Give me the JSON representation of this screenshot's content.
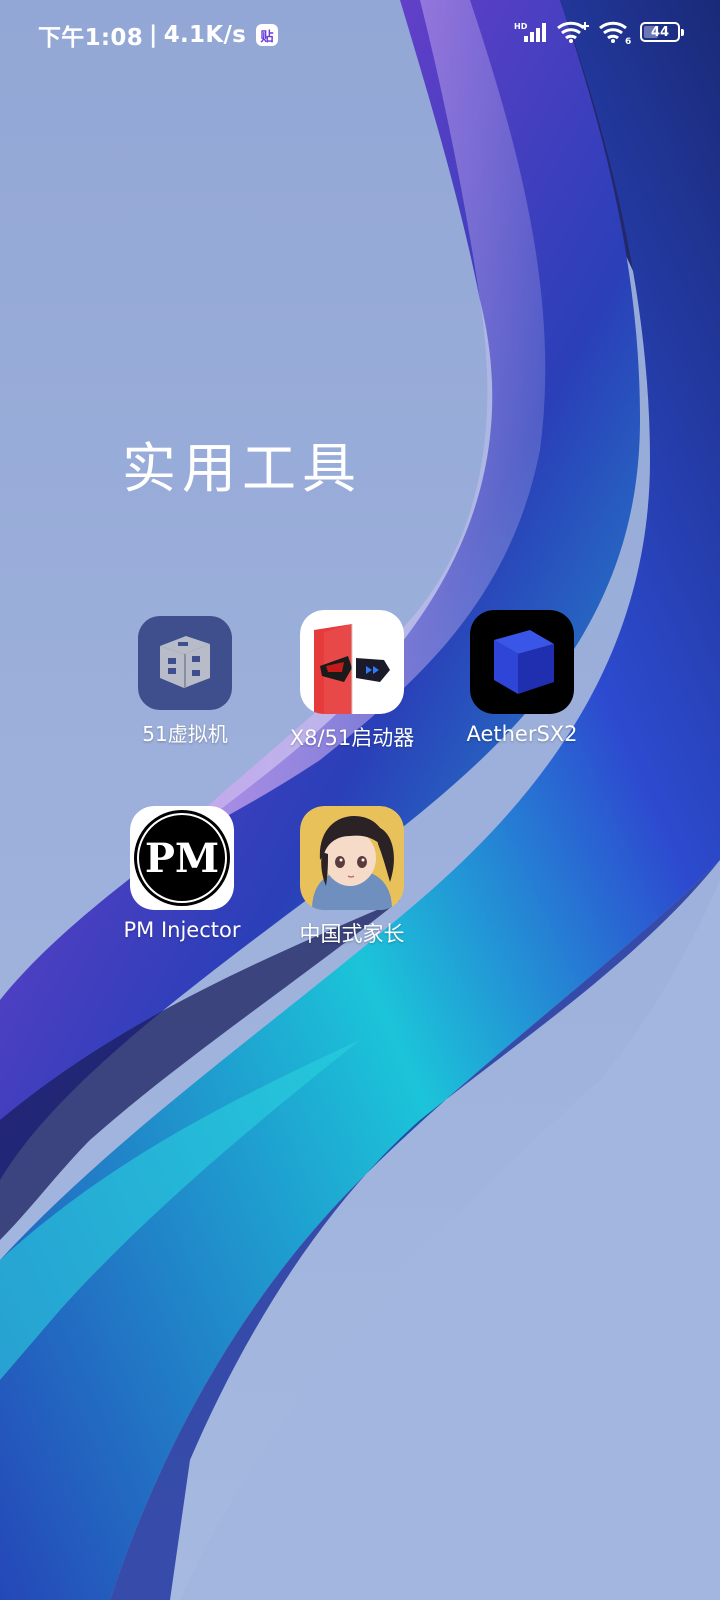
{
  "status_bar": {
    "time": "下午1:08",
    "separator": "|",
    "network_speed": "4.1K/s",
    "notification_badge": "贴",
    "battery_level": "44",
    "battery_percent": 44,
    "icons": [
      "hd-signal-icon",
      "wifi-plus-icon",
      "wifi-6-icon",
      "battery-icon"
    ]
  },
  "folder": {
    "title": "实用工具",
    "apps": [
      {
        "label": "51虚拟机",
        "icon": "virtual-machine-cube-icon"
      },
      {
        "label": "X8/51启动器",
        "icon": "launcher-split-face-icon"
      },
      {
        "label": "AetherSX2",
        "icon": "blue-cube-icon"
      },
      {
        "label": "PM Injector",
        "icon": "pm-logo-icon"
      },
      {
        "label": "中国式家长",
        "icon": "anime-girl-icon"
      }
    ]
  },
  "colors": {
    "wallpaper_base": "#9fb3dc",
    "accent_purple": "#7a3fc9",
    "accent_cyan": "#19b7d8",
    "accent_blue": "#2a4fc8"
  }
}
